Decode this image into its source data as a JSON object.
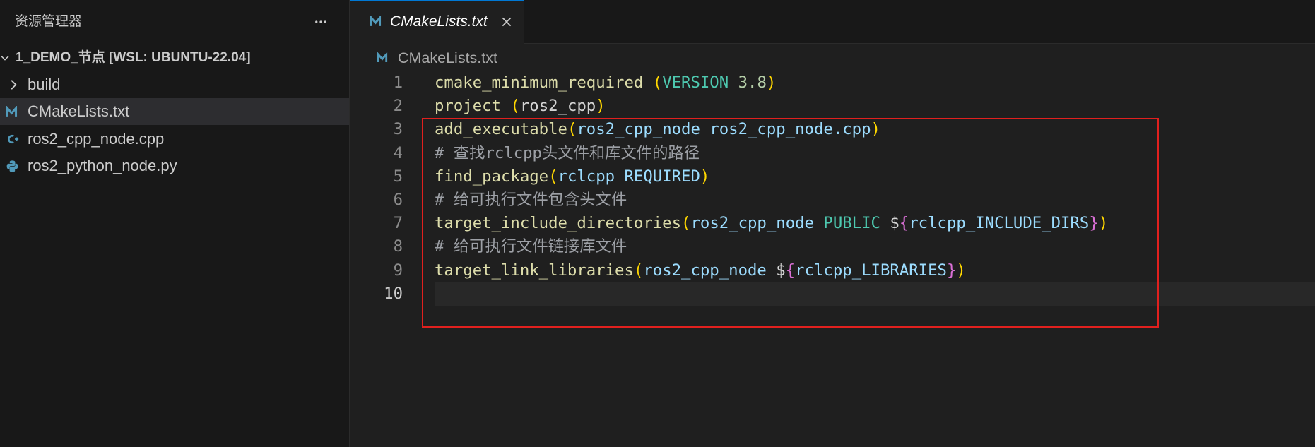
{
  "sidebar": {
    "title": "资源管理器",
    "more_icon": "more-actions-icon",
    "workspace": {
      "label": "1_DEMO_节点 [WSL: UBUNTU-22.04]",
      "expanded": true,
      "icon": "chevron-down-icon"
    },
    "items": [
      {
        "label": "build",
        "kind": "folder",
        "icon": "chevron-right-icon",
        "selected": false
      },
      {
        "label": "CMakeLists.txt",
        "kind": "file",
        "icon": "cmake-icon",
        "selected": true
      },
      {
        "label": "ros2_cpp_node.cpp",
        "kind": "file",
        "icon": "cpp-icon",
        "selected": false
      },
      {
        "label": "ros2_python_node.py",
        "kind": "file",
        "icon": "python-icon",
        "selected": false
      }
    ]
  },
  "tabs": [
    {
      "label": "CMakeLists.txt",
      "active": true,
      "preview": true,
      "icon": "cmake-icon",
      "close_icon": "close-icon"
    }
  ],
  "breadcrumb": {
    "items": [
      {
        "label": "CMakeLists.txt",
        "icon": "cmake-icon"
      }
    ]
  },
  "editor": {
    "current_line": 10,
    "lines": [
      {
        "number": 1,
        "tokens": [
          {
            "text": "cmake_minimum_required ",
            "kind": "function"
          },
          {
            "text": "(",
            "kind": "paren"
          },
          {
            "text": "VERSION ",
            "kind": "keyword"
          },
          {
            "text": "3.8",
            "kind": "number"
          },
          {
            "text": ")",
            "kind": "paren"
          }
        ]
      },
      {
        "number": 2,
        "tokens": [
          {
            "text": "project ",
            "kind": "function"
          },
          {
            "text": "(",
            "kind": "paren"
          },
          {
            "text": "ros2_cpp",
            "kind": "plain"
          },
          {
            "text": ")",
            "kind": "paren"
          }
        ]
      },
      {
        "number": 3,
        "tokens": [
          {
            "text": "add_executable",
            "kind": "function"
          },
          {
            "text": "(",
            "kind": "paren"
          },
          {
            "text": "ros2_cpp_node ros2_cpp_node.cpp",
            "kind": "argument"
          },
          {
            "text": ")",
            "kind": "paren"
          }
        ]
      },
      {
        "number": 4,
        "tokens": [
          {
            "text": "# 查找rclcpp头文件和库文件的路径",
            "kind": "comment"
          }
        ]
      },
      {
        "number": 5,
        "tokens": [
          {
            "text": "find_package",
            "kind": "function"
          },
          {
            "text": "(",
            "kind": "paren"
          },
          {
            "text": "rclcpp REQUIRED",
            "kind": "argument"
          },
          {
            "text": ")",
            "kind": "paren"
          }
        ]
      },
      {
        "number": 6,
        "tokens": [
          {
            "text": "# 给可执行文件包含头文件",
            "kind": "comment"
          }
        ]
      },
      {
        "number": 7,
        "tokens": [
          {
            "text": "target_include_directories",
            "kind": "function"
          },
          {
            "text": "(",
            "kind": "paren"
          },
          {
            "text": "ros2_cpp_node ",
            "kind": "argument"
          },
          {
            "text": "PUBLIC",
            "kind": "keyword"
          },
          {
            "text": " $",
            "kind": "plain"
          },
          {
            "text": "{",
            "kind": "brace"
          },
          {
            "text": "rclcpp_INCLUDE_DIRS",
            "kind": "argument"
          },
          {
            "text": "}",
            "kind": "brace"
          },
          {
            "text": ")",
            "kind": "paren"
          }
        ]
      },
      {
        "number": 8,
        "tokens": [
          {
            "text": "# 给可执行文件链接库文件",
            "kind": "comment"
          }
        ]
      },
      {
        "number": 9,
        "tokens": [
          {
            "text": "target_link_libraries",
            "kind": "function"
          },
          {
            "text": "(",
            "kind": "paren"
          },
          {
            "text": "ros2_cpp_node ",
            "kind": "argument"
          },
          {
            "text": "$",
            "kind": "plain"
          },
          {
            "text": "{",
            "kind": "brace"
          },
          {
            "text": "rclcpp_LIBRARIES",
            "kind": "argument"
          },
          {
            "text": "}",
            "kind": "brace"
          },
          {
            "text": ")",
            "kind": "paren"
          }
        ]
      },
      {
        "number": 10,
        "tokens": []
      }
    ]
  },
  "theme": {
    "accent": "#0078d4",
    "file_icon": "#519aba",
    "annotation_box": "#e0201e",
    "syntax": {
      "function": "#dcdcaa",
      "paren": "#ffd700",
      "brace": "#da70d6",
      "keyword": "#4ec9b0",
      "number": "#b5cea8",
      "argument": "#9cdcfe",
      "plain": "#d4d4d4",
      "comment": "#9da0a6"
    }
  }
}
